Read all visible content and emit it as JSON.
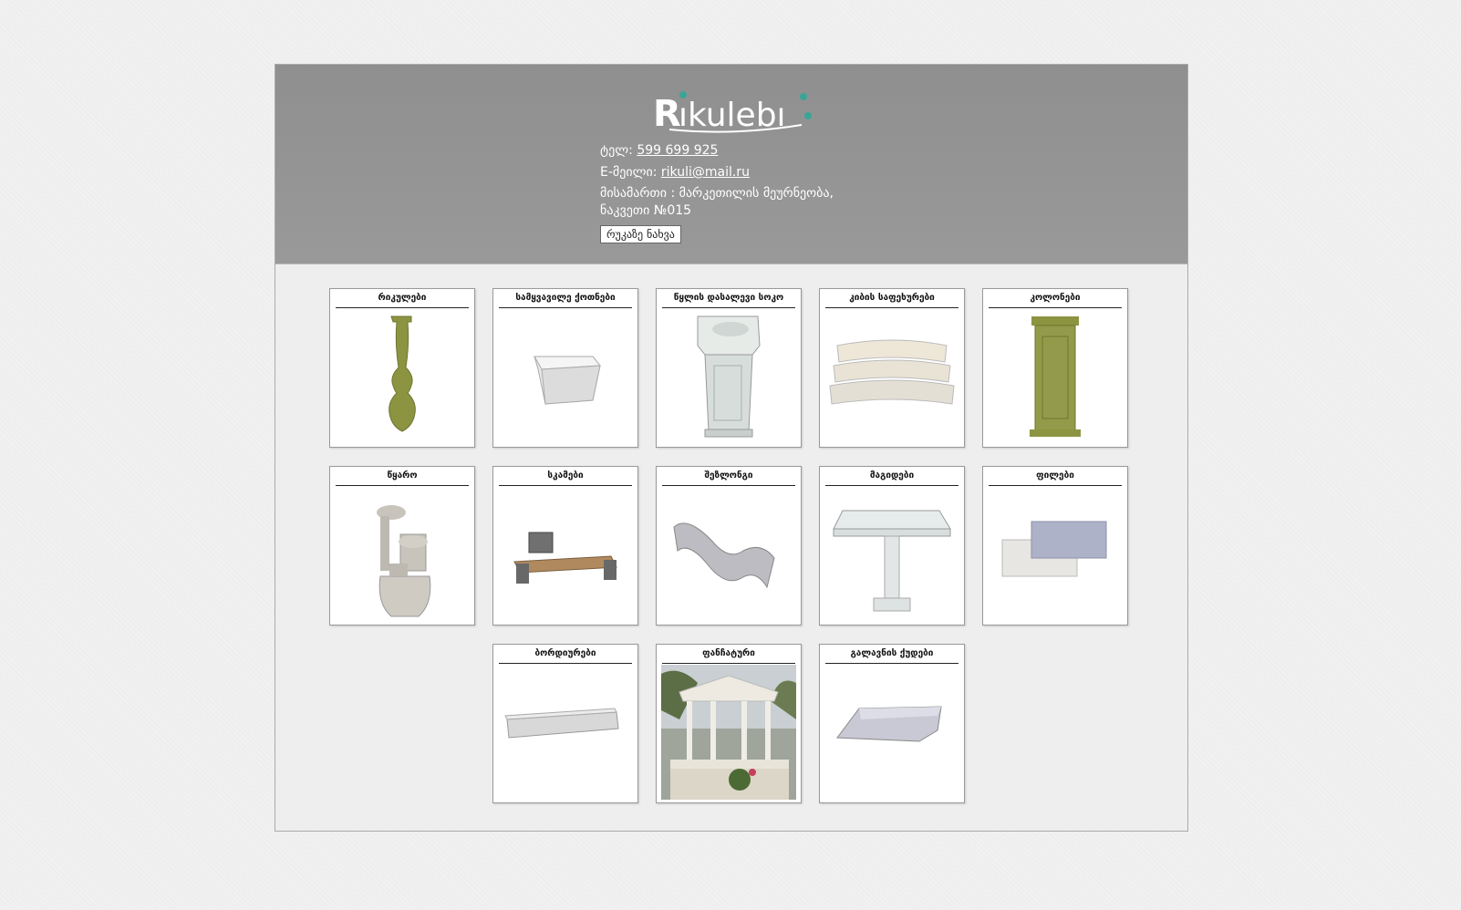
{
  "header": {
    "logo_text": "Rikulebi",
    "phone_label": "ტელ:",
    "phone_value": "599 699 925",
    "email_label": "E-მეილი:",
    "email_value": "rikuli@mail.ru",
    "address": "მისამართი : მარკეთილის მეურნეობა, ნაკვეთი №015",
    "map_button": "რუკაზე ნახვა"
  },
  "products": [
    {
      "title": "რიკულები",
      "icon": "baluster-image"
    },
    {
      "title": "სამყვავილე ქოთნები",
      "icon": "flower-pot-image"
    },
    {
      "title": "წყლის დასალევი სოკო",
      "icon": "drinking-fountain-image"
    },
    {
      "title": "კიბის საფეხურები",
      "icon": "stair-steps-image"
    },
    {
      "title": "კოლონები",
      "icon": "column-image"
    },
    {
      "title": "წყარო",
      "icon": "water-fountain-image"
    },
    {
      "title": "სკამები",
      "icon": "bench-image"
    },
    {
      "title": "შეზლონგი",
      "icon": "chaise-lounge-image"
    },
    {
      "title": "მაგიდები",
      "icon": "table-image"
    },
    {
      "title": "ფილები",
      "icon": "tiles-image"
    },
    {
      "title": "ბორდიურები",
      "icon": "curb-image"
    },
    {
      "title": "ფანჩატური",
      "icon": "gazebo-image"
    },
    {
      "title": "გალავნის ქუდები",
      "icon": "wall-cap-image"
    }
  ],
  "colors": {
    "header_bg": "#959595",
    "logo_accent": "#3aa597",
    "olive": "#8c9441",
    "stone": "#d8d8d8"
  }
}
